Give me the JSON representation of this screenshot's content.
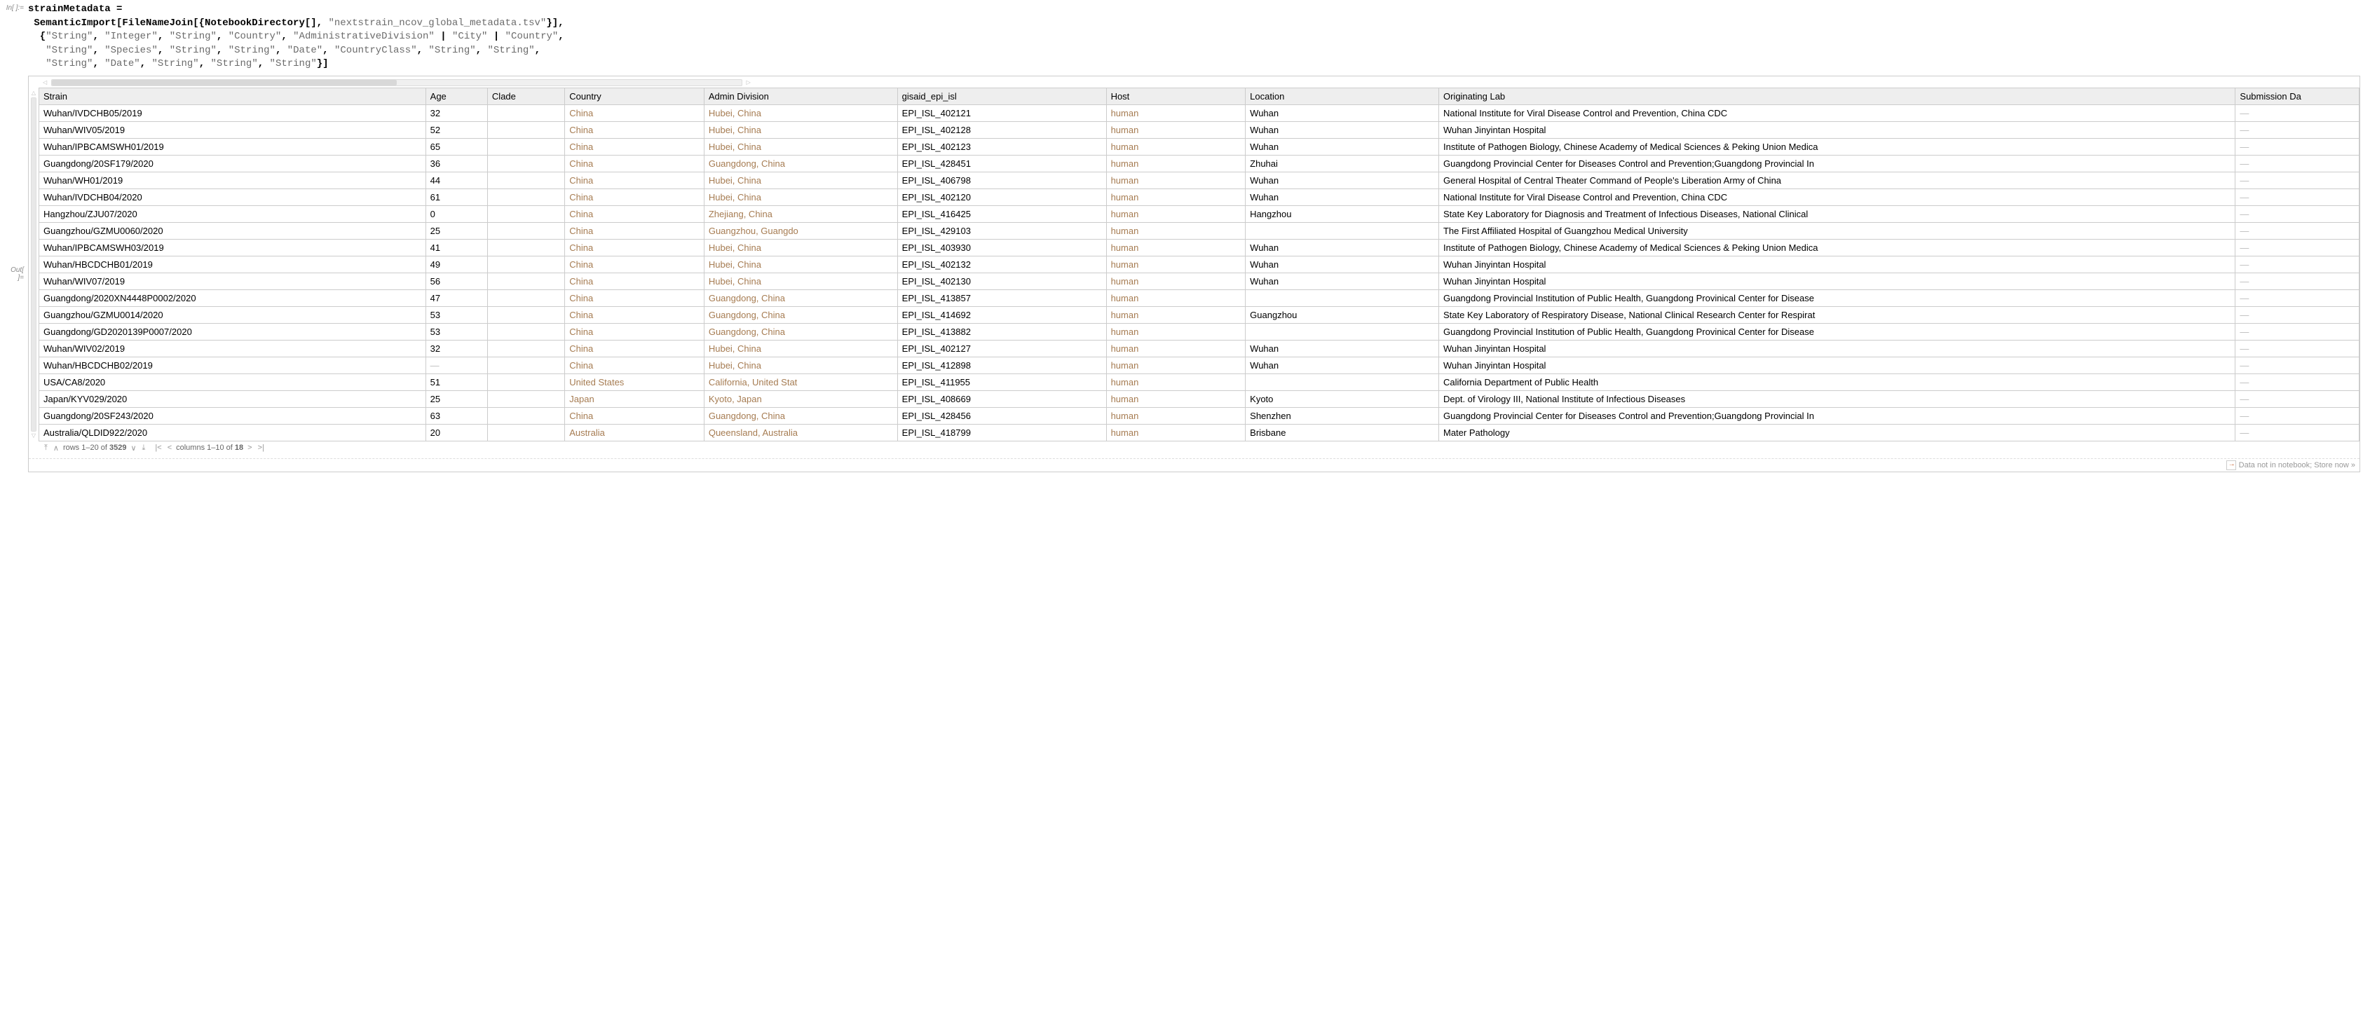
{
  "input_label": "In[ ]:=",
  "output_label": "Out[ ]=",
  "code_lines": [
    [
      {
        "t": "norm",
        "v": "strainMetadata = "
      }
    ],
    [
      {
        "t": "norm",
        "v": " SemanticImport[FileNameJoin[{NotebookDirectory[], "
      },
      {
        "t": "str",
        "v": "\"nextstrain_ncov_global_metadata.tsv\""
      },
      {
        "t": "norm",
        "v": "}],"
      }
    ],
    [
      {
        "t": "norm",
        "v": "  {"
      },
      {
        "t": "str",
        "v": "\"String\""
      },
      {
        "t": "norm",
        "v": ", "
      },
      {
        "t": "str",
        "v": "\"Integer\""
      },
      {
        "t": "norm",
        "v": ", "
      },
      {
        "t": "str",
        "v": "\"String\""
      },
      {
        "t": "norm",
        "v": ", "
      },
      {
        "t": "str",
        "v": "\"Country\""
      },
      {
        "t": "norm",
        "v": ", "
      },
      {
        "t": "str",
        "v": "\"AdministrativeDivision\""
      },
      {
        "t": "norm",
        "v": " | "
      },
      {
        "t": "str",
        "v": "\"City\""
      },
      {
        "t": "norm",
        "v": " | "
      },
      {
        "t": "str",
        "v": "\"Country\""
      },
      {
        "t": "norm",
        "v": ","
      }
    ],
    [
      {
        "t": "norm",
        "v": "   "
      },
      {
        "t": "str",
        "v": "\"String\""
      },
      {
        "t": "norm",
        "v": ", "
      },
      {
        "t": "str",
        "v": "\"Species\""
      },
      {
        "t": "norm",
        "v": ", "
      },
      {
        "t": "str",
        "v": "\"String\""
      },
      {
        "t": "norm",
        "v": ", "
      },
      {
        "t": "str",
        "v": "\"String\""
      },
      {
        "t": "norm",
        "v": ", "
      },
      {
        "t": "str",
        "v": "\"Date\""
      },
      {
        "t": "norm",
        "v": ", "
      },
      {
        "t": "str",
        "v": "\"CountryClass\""
      },
      {
        "t": "norm",
        "v": ", "
      },
      {
        "t": "str",
        "v": "\"String\""
      },
      {
        "t": "norm",
        "v": ", "
      },
      {
        "t": "str",
        "v": "\"String\""
      },
      {
        "t": "norm",
        "v": ","
      }
    ],
    [
      {
        "t": "norm",
        "v": "   "
      },
      {
        "t": "str",
        "v": "\"String\""
      },
      {
        "t": "norm",
        "v": ", "
      },
      {
        "t": "str",
        "v": "\"Date\""
      },
      {
        "t": "norm",
        "v": ", "
      },
      {
        "t": "str",
        "v": "\"String\""
      },
      {
        "t": "norm",
        "v": ", "
      },
      {
        "t": "str",
        "v": "\"String\""
      },
      {
        "t": "norm",
        "v": ", "
      },
      {
        "t": "str",
        "v": "\"String\""
      },
      {
        "t": "norm",
        "v": "}]"
      }
    ]
  ],
  "columns": [
    "Strain",
    "Age",
    "Clade",
    "Country",
    "Admin Division",
    "gisaid_epi_isl",
    "Host",
    "Location",
    "Originating Lab",
    "Submission Da"
  ],
  "col_widths": [
    "250px",
    "40px",
    "50px",
    "90px",
    "125px",
    "135px",
    "90px",
    "125px",
    "515px",
    "80px"
  ],
  "entity_cols": [
    3,
    4,
    6
  ],
  "rows": [
    [
      "Wuhan/IVDCHB05/2019",
      "32",
      "",
      "China",
      "Hubei, China",
      "EPI_ISL_402121",
      "human",
      "Wuhan",
      "National Institute for Viral Disease Control and Prevention, China CDC",
      "—"
    ],
    [
      "Wuhan/WIV05/2019",
      "52",
      "",
      "China",
      "Hubei, China",
      "EPI_ISL_402128",
      "human",
      "Wuhan",
      "Wuhan Jinyintan Hospital",
      "—"
    ],
    [
      "Wuhan/IPBCAMSWH01/2019",
      "65",
      "",
      "China",
      "Hubei, China",
      "EPI_ISL_402123",
      "human",
      "Wuhan",
      "Institute of Pathogen Biology, Chinese Academy of Medical Sciences & Peking Union Medica",
      "—"
    ],
    [
      "Guangdong/20SF179/2020",
      "36",
      "",
      "China",
      "Guangdong, China",
      "EPI_ISL_428451",
      "human",
      "Zhuhai",
      "Guangdong Provincial Center for Diseases Control and Prevention;Guangdong Provincial In",
      "—"
    ],
    [
      "Wuhan/WH01/2019",
      "44",
      "",
      "China",
      "Hubei, China",
      "EPI_ISL_406798",
      "human",
      "Wuhan",
      "General Hospital of Central Theater Command of People's Liberation Army of China",
      "—"
    ],
    [
      "Wuhan/IVDCHB04/2020",
      "61",
      "",
      "China",
      "Hubei, China",
      "EPI_ISL_402120",
      "human",
      "Wuhan",
      "National Institute for Viral Disease Control and Prevention, China CDC",
      "—"
    ],
    [
      "Hangzhou/ZJU07/2020",
      "0",
      "",
      "China",
      "Zhejiang, China",
      "EPI_ISL_416425",
      "human",
      "Hangzhou",
      "State Key Laboratory for Diagnosis and Treatment of Infectious Diseases, National Clinical",
      "—"
    ],
    [
      "Guangzhou/GZMU0060/2020",
      "25",
      "",
      "China",
      "Guangzhou, Guangdo",
      "EPI_ISL_429103",
      "human",
      "",
      "The First Affiliated Hospital of Guangzhou Medical University",
      "—"
    ],
    [
      "Wuhan/IPBCAMSWH03/2019",
      "41",
      "",
      "China",
      "Hubei, China",
      "EPI_ISL_403930",
      "human",
      "Wuhan",
      "Institute of Pathogen Biology, Chinese Academy of Medical Sciences & Peking Union Medica",
      "—"
    ],
    [
      "Wuhan/HBCDCHB01/2019",
      "49",
      "",
      "China",
      "Hubei, China",
      "EPI_ISL_402132",
      "human",
      "Wuhan",
      "Wuhan Jinyintan Hospital",
      "—"
    ],
    [
      "Wuhan/WIV07/2019",
      "56",
      "",
      "China",
      "Hubei, China",
      "EPI_ISL_402130",
      "human",
      "Wuhan",
      "Wuhan Jinyintan Hospital",
      "—"
    ],
    [
      "Guangdong/2020XN4448P0002/2020",
      "47",
      "",
      "China",
      "Guangdong, China",
      "EPI_ISL_413857",
      "human",
      "",
      "Guangdong Provincial Institution of Public Health, Guangdong Provinical Center for Disease",
      "—"
    ],
    [
      "Guangzhou/GZMU0014/2020",
      "53",
      "",
      "China",
      "Guangdong, China",
      "EPI_ISL_414692",
      "human",
      "Guangzhou",
      "State Key Laboratory of Respiratory Disease, National Clinical Research Center for Respirat",
      "—"
    ],
    [
      "Guangdong/GD2020139P0007/2020",
      "53",
      "",
      "China",
      "Guangdong, China",
      "EPI_ISL_413882",
      "human",
      "",
      "Guangdong Provincial Institution of Public Health, Guangdong Provinical Center for Disease",
      "—"
    ],
    [
      "Wuhan/WIV02/2019",
      "32",
      "",
      "China",
      "Hubei, China",
      "EPI_ISL_402127",
      "human",
      "Wuhan",
      "Wuhan Jinyintan Hospital",
      "—"
    ],
    [
      "Wuhan/HBCDCHB02/2019",
      "—",
      "",
      "China",
      "Hubei, China",
      "EPI_ISL_412898",
      "human",
      "Wuhan",
      "Wuhan Jinyintan Hospital",
      "—"
    ],
    [
      "USA/CA8/2020",
      "51",
      "",
      "United States",
      "California, United Stat",
      "EPI_ISL_411955",
      "human",
      "",
      "California Department of Public Health",
      "—"
    ],
    [
      "Japan/KYV029/2020",
      "25",
      "",
      "Japan",
      "Kyoto, Japan",
      "EPI_ISL_408669",
      "human",
      "Kyoto",
      "Dept. of Virology III, National Institute of Infectious Diseases",
      "—"
    ],
    [
      "Guangdong/20SF243/2020",
      "63",
      "",
      "China",
      "Guangdong, China",
      "EPI_ISL_428456",
      "human",
      "Shenzhen",
      "Guangdong Provincial Center for Diseases Control and Prevention;Guangdong Provincial In",
      "—"
    ],
    [
      "Australia/QLDID922/2020",
      "20",
      "",
      "Australia",
      "Queensland, Australia",
      "EPI_ISL_418799",
      "human",
      "Brisbane",
      "Mater Pathology",
      "—"
    ]
  ],
  "footer": {
    "rows_label_prefix": "rows 1–20 of ",
    "rows_total": "3529",
    "cols_label": "columns 1–10 of ",
    "cols_total": "18"
  },
  "store_msg": "Data not in notebook; Store now »"
}
